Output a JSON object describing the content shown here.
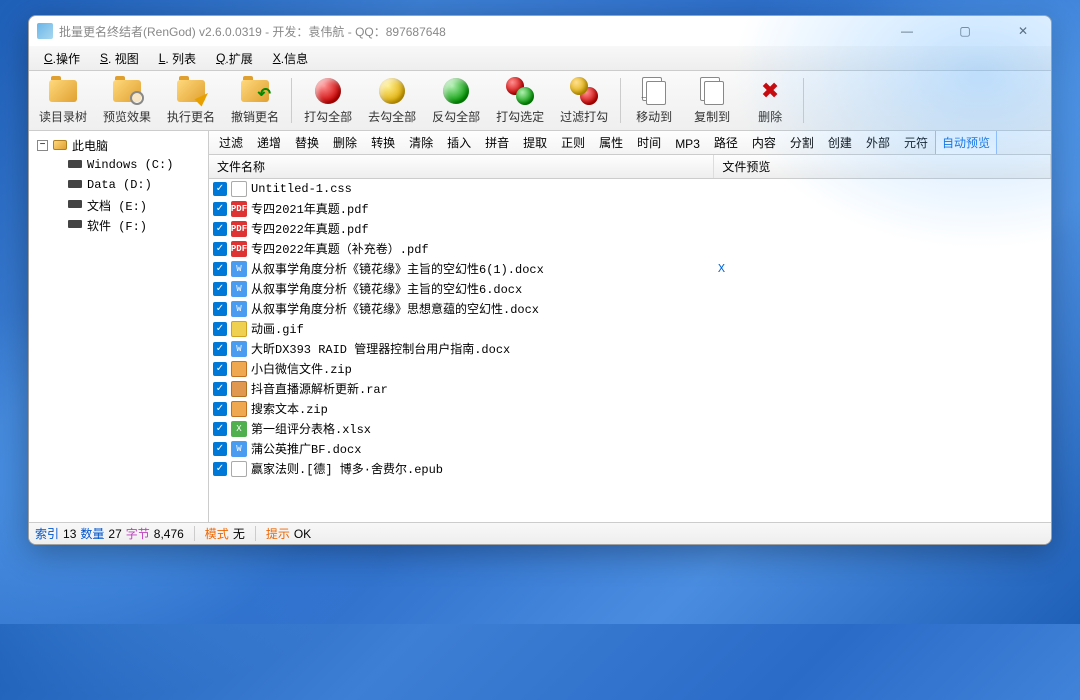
{
  "window": {
    "title": "批量更名终结者(RenGod) v2.6.0.0319 - 开发：袁伟航 - QQ：897687648"
  },
  "menu": {
    "operate": {
      "prefix": "C",
      "label": ".操作"
    },
    "view": {
      "prefix": "S",
      "label": ". 视图"
    },
    "list": {
      "prefix": "L",
      "label": ". 列表"
    },
    "extend": {
      "prefix": "Q",
      "label": ".扩展"
    },
    "info": {
      "prefix": "X",
      "label": ".信息"
    }
  },
  "toolbar": {
    "read_tree": "读目录树",
    "preview": "预览效果",
    "execute": "执行更名",
    "undo": "撤销更名",
    "check_all": "打勾全部",
    "uncheck_all": "去勾全部",
    "invert_check": "反勾全部",
    "check_selected": "打勾选定",
    "filter_check": "过滤打勾",
    "move_to": "移动到",
    "copy_to": "复制到",
    "delete": "删除"
  },
  "tabs": [
    "过滤",
    "递增",
    "替换",
    "删除",
    "转换",
    "清除",
    "插入",
    "拼音",
    "提取",
    "正则",
    "属性",
    "时间",
    "MP3",
    "路径",
    "内容",
    "分割",
    "创建",
    "外部",
    "元符",
    "自动预览"
  ],
  "active_tab": "自动预览",
  "tree": {
    "root": "此电脑",
    "drives": [
      {
        "label": "Windows (C:)"
      },
      {
        "label": "Data (D:)"
      },
      {
        "label": "文档 (E:)"
      },
      {
        "label": "软件 (F:)"
      }
    ]
  },
  "columns": {
    "filename": "文件名称",
    "preview": "文件预览"
  },
  "files": [
    {
      "name": "Untitled-1.css",
      "icon": "css",
      "preview": ""
    },
    {
      "name": "专四2021年真题.pdf",
      "icon": "pdf",
      "preview": ""
    },
    {
      "name": "专四2022年真题.pdf",
      "icon": "pdf",
      "preview": ""
    },
    {
      "name": "专四2022年真题（补充卷）.pdf",
      "icon": "pdf",
      "preview": ""
    },
    {
      "name": "从叙事学角度分析《镜花缘》主旨的空幻性6(1).docx",
      "icon": "docx",
      "preview": "X"
    },
    {
      "name": "从叙事学角度分析《镜花缘》主旨的空幻性6.docx",
      "icon": "docx",
      "preview": ""
    },
    {
      "name": "从叙事学角度分析《镜花缘》思想意蕴的空幻性.docx",
      "icon": "docx",
      "preview": ""
    },
    {
      "name": "动画.gif",
      "icon": "gif",
      "preview": ""
    },
    {
      "name": "大昕DX393 RAID 管理器控制台用户指南.docx",
      "icon": "docx",
      "preview": ""
    },
    {
      "name": "小白微信文件.zip",
      "icon": "zip",
      "preview": ""
    },
    {
      "name": "抖音直播源解析更新.rar",
      "icon": "rar",
      "preview": ""
    },
    {
      "name": "搜索文本.zip",
      "icon": "zip",
      "preview": ""
    },
    {
      "name": "第一组评分表格.xlsx",
      "icon": "xlsx",
      "preview": ""
    },
    {
      "name": "蒲公英推广BF.docx",
      "icon": "docx",
      "preview": ""
    },
    {
      "name": "赢家法则.[德] 博多·舍费尔.epub",
      "icon": "epub",
      "preview": ""
    }
  ],
  "status": {
    "index_label": "索引",
    "index_val": "13",
    "count_label": "数量",
    "count_val": "27",
    "bytes_label": "字节",
    "bytes_val": "8,476",
    "mode_label": "模式",
    "mode_val": "无",
    "hint_label": "提示",
    "hint_val": "OK"
  }
}
